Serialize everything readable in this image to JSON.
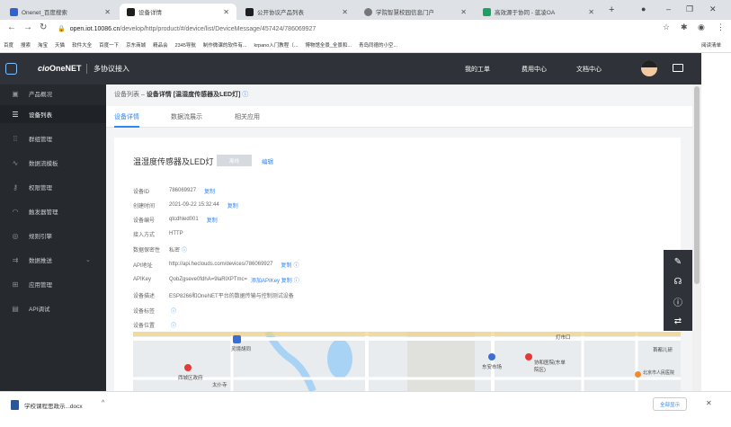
{
  "browser": {
    "tabs": [
      {
        "title": "Onenet_百度搜索",
        "color": "#d94a38"
      },
      {
        "title": "设备详情",
        "color": "#1f1f1f"
      },
      {
        "title": "公开协议产品列表",
        "color": "#1f1f1f"
      },
      {
        "title": "学院智慧校园信息门户",
        "color": "#666"
      },
      {
        "title": "高效源于协同 - 蓝凌OA",
        "color": "#1aa260"
      }
    ],
    "new_tab": "+",
    "url_host": "open.iot.10086.cn",
    "url_path": "/develop/http/product/#/device/list/DeviceMessage/457424/786069927",
    "bookmarks": [
      "百度",
      "搜索",
      "淘宝",
      "天猫",
      "软件大全",
      "百度一下",
      "京东商城",
      "精品会",
      "2345导航",
      "制作微课的软件有...",
      "krpano入门教程（...",
      "博物馆全景_全景和...",
      "青岛同德的小空..."
    ],
    "reading_list": "阅读清单"
  },
  "header": {
    "brand": "OneNET",
    "section": "多协议接入",
    "links": [
      "我的工单",
      "费用中心",
      "文档中心"
    ]
  },
  "sidebar": {
    "items": [
      {
        "label": "产品概况",
        "icon": "product-icon"
      },
      {
        "label": "设备列表",
        "icon": "list-icon"
      },
      {
        "label": "群组管理",
        "icon": "group-icon"
      },
      {
        "label": "数据流模板",
        "icon": "datastream-icon"
      },
      {
        "label": "权限管理",
        "icon": "key-icon"
      },
      {
        "label": "触发器管理",
        "icon": "trigger-icon"
      },
      {
        "label": "规则引擎",
        "icon": "rule-icon"
      },
      {
        "label": "数据推送",
        "icon": "push-icon"
      },
      {
        "label": "应用管理",
        "icon": "app-icon"
      },
      {
        "label": "API调试",
        "icon": "api-icon"
      }
    ]
  },
  "breadcrumb": {
    "prefix": "设备列表 –",
    "current": "设备详情 [温湿度传感器及LED灯]"
  },
  "subtabs": [
    "设备详情",
    "数据流展示",
    "相关应用"
  ],
  "device": {
    "name": "温湿度传感器及LED灯",
    "status": "离线",
    "edit": "编辑",
    "fields": [
      {
        "key": "设备ID",
        "value": "786069927",
        "copy": "复制"
      },
      {
        "key": "创建时间",
        "value": "2021-09-22 15:32:44",
        "copy": "复制"
      },
      {
        "key": "设备编号",
        "value": "qtcdhled001",
        "copy": "复制"
      },
      {
        "key": "接入方式",
        "value": "HTTP",
        "copy": ""
      },
      {
        "key": "数据保密性",
        "value": "私密",
        "copy": ""
      },
      {
        "key": "API地址",
        "value": "http://api.heclouds.com/devices/786069927",
        "copy": "复制"
      },
      {
        "key": "APIKey",
        "value": "QobZgseve0fdhA=9laRlXPTmc=",
        "copy": "添加APIKey   复制"
      },
      {
        "key": "设备描述",
        "value": "ESP8266和OneNET平台的数据传输与控制测试设备",
        "copy": ""
      },
      {
        "key": "设备标签",
        "value": "",
        "copy": ""
      },
      {
        "key": "设备位置",
        "value": "",
        "copy": ""
      }
    ]
  },
  "map": {
    "labels": [
      "灵境胡同",
      "西城区政府",
      "太仆寺",
      "东安市场",
      "协和医院(东单院区)",
      "北京市人民医院",
      "灯市口",
      "首都儿研"
    ]
  },
  "download": {
    "file": "学校课程思政示...docx",
    "show_all": "全部显示"
  }
}
